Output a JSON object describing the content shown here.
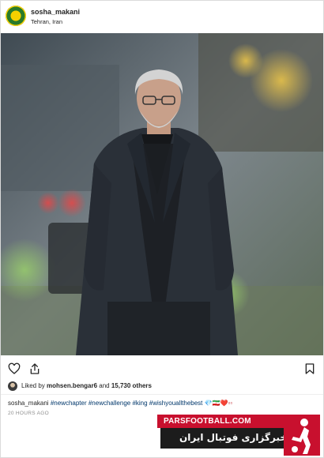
{
  "post": {
    "username": "sosha_makani",
    "location": "Tehran, Iran",
    "photo_icon": "person-photo",
    "likes": {
      "prefix": "Liked by ",
      "user": "mohsen.bengar6",
      "middle": " and ",
      "count": "15,730 others"
    },
    "caption": {
      "username": "sosha_makani",
      "tags": " #newchapter #newchallenge #king #wishyouallthebest",
      "emojis": " 💎🇮🇷❤️▫▫"
    },
    "timestamp": "20 HOURS AGO"
  },
  "icons": {
    "like": "heart-icon",
    "share": "share-icon",
    "save": "bookmark-icon"
  },
  "watermark": {
    "top": "PARSFOOTBALL.COM",
    "bottom": "خبرگزاری فوتبال ایران"
  },
  "colors": {
    "tag_link": "#00376b",
    "watermark_red": "#c8102e",
    "watermark_dark": "#1c1c1c"
  }
}
